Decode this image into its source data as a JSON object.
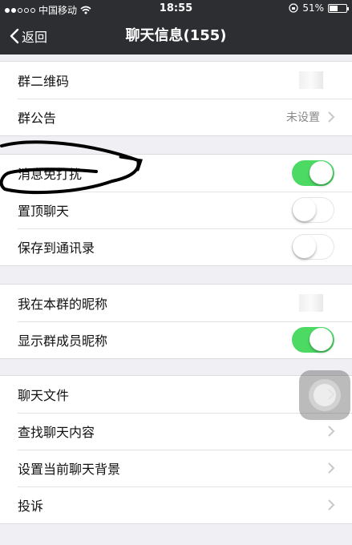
{
  "status": {
    "carrier": "中国移动",
    "time": "18:55",
    "battery": "51%",
    "battery_level": 0.51,
    "signal_bars_filled": 2,
    "signal_bars_total": 5
  },
  "nav": {
    "back_label": "返回",
    "title": "聊天信息(155)"
  },
  "sections": {
    "group_info": {
      "qr_label": "群二维码",
      "notice_label": "群公告",
      "notice_value": "未设置"
    },
    "settings": {
      "mute_label": "消息免打扰",
      "mute_on": true,
      "pin_label": "置顶聊天",
      "pin_on": false,
      "save_label": "保存到通讯录",
      "save_on": false
    },
    "nickname": {
      "my_nick_label": "我在本群的昵称",
      "show_nick_label": "显示群成员昵称",
      "show_nick_on": true
    },
    "more": {
      "files_label": "聊天文件",
      "search_label": "查找聊天内容",
      "bg_label": "设置当前聊天背景",
      "report_label": "投诉"
    }
  },
  "colors": {
    "bar": "#2d2e32",
    "toggle_on": "#4cd964",
    "background": "#efeff4"
  }
}
